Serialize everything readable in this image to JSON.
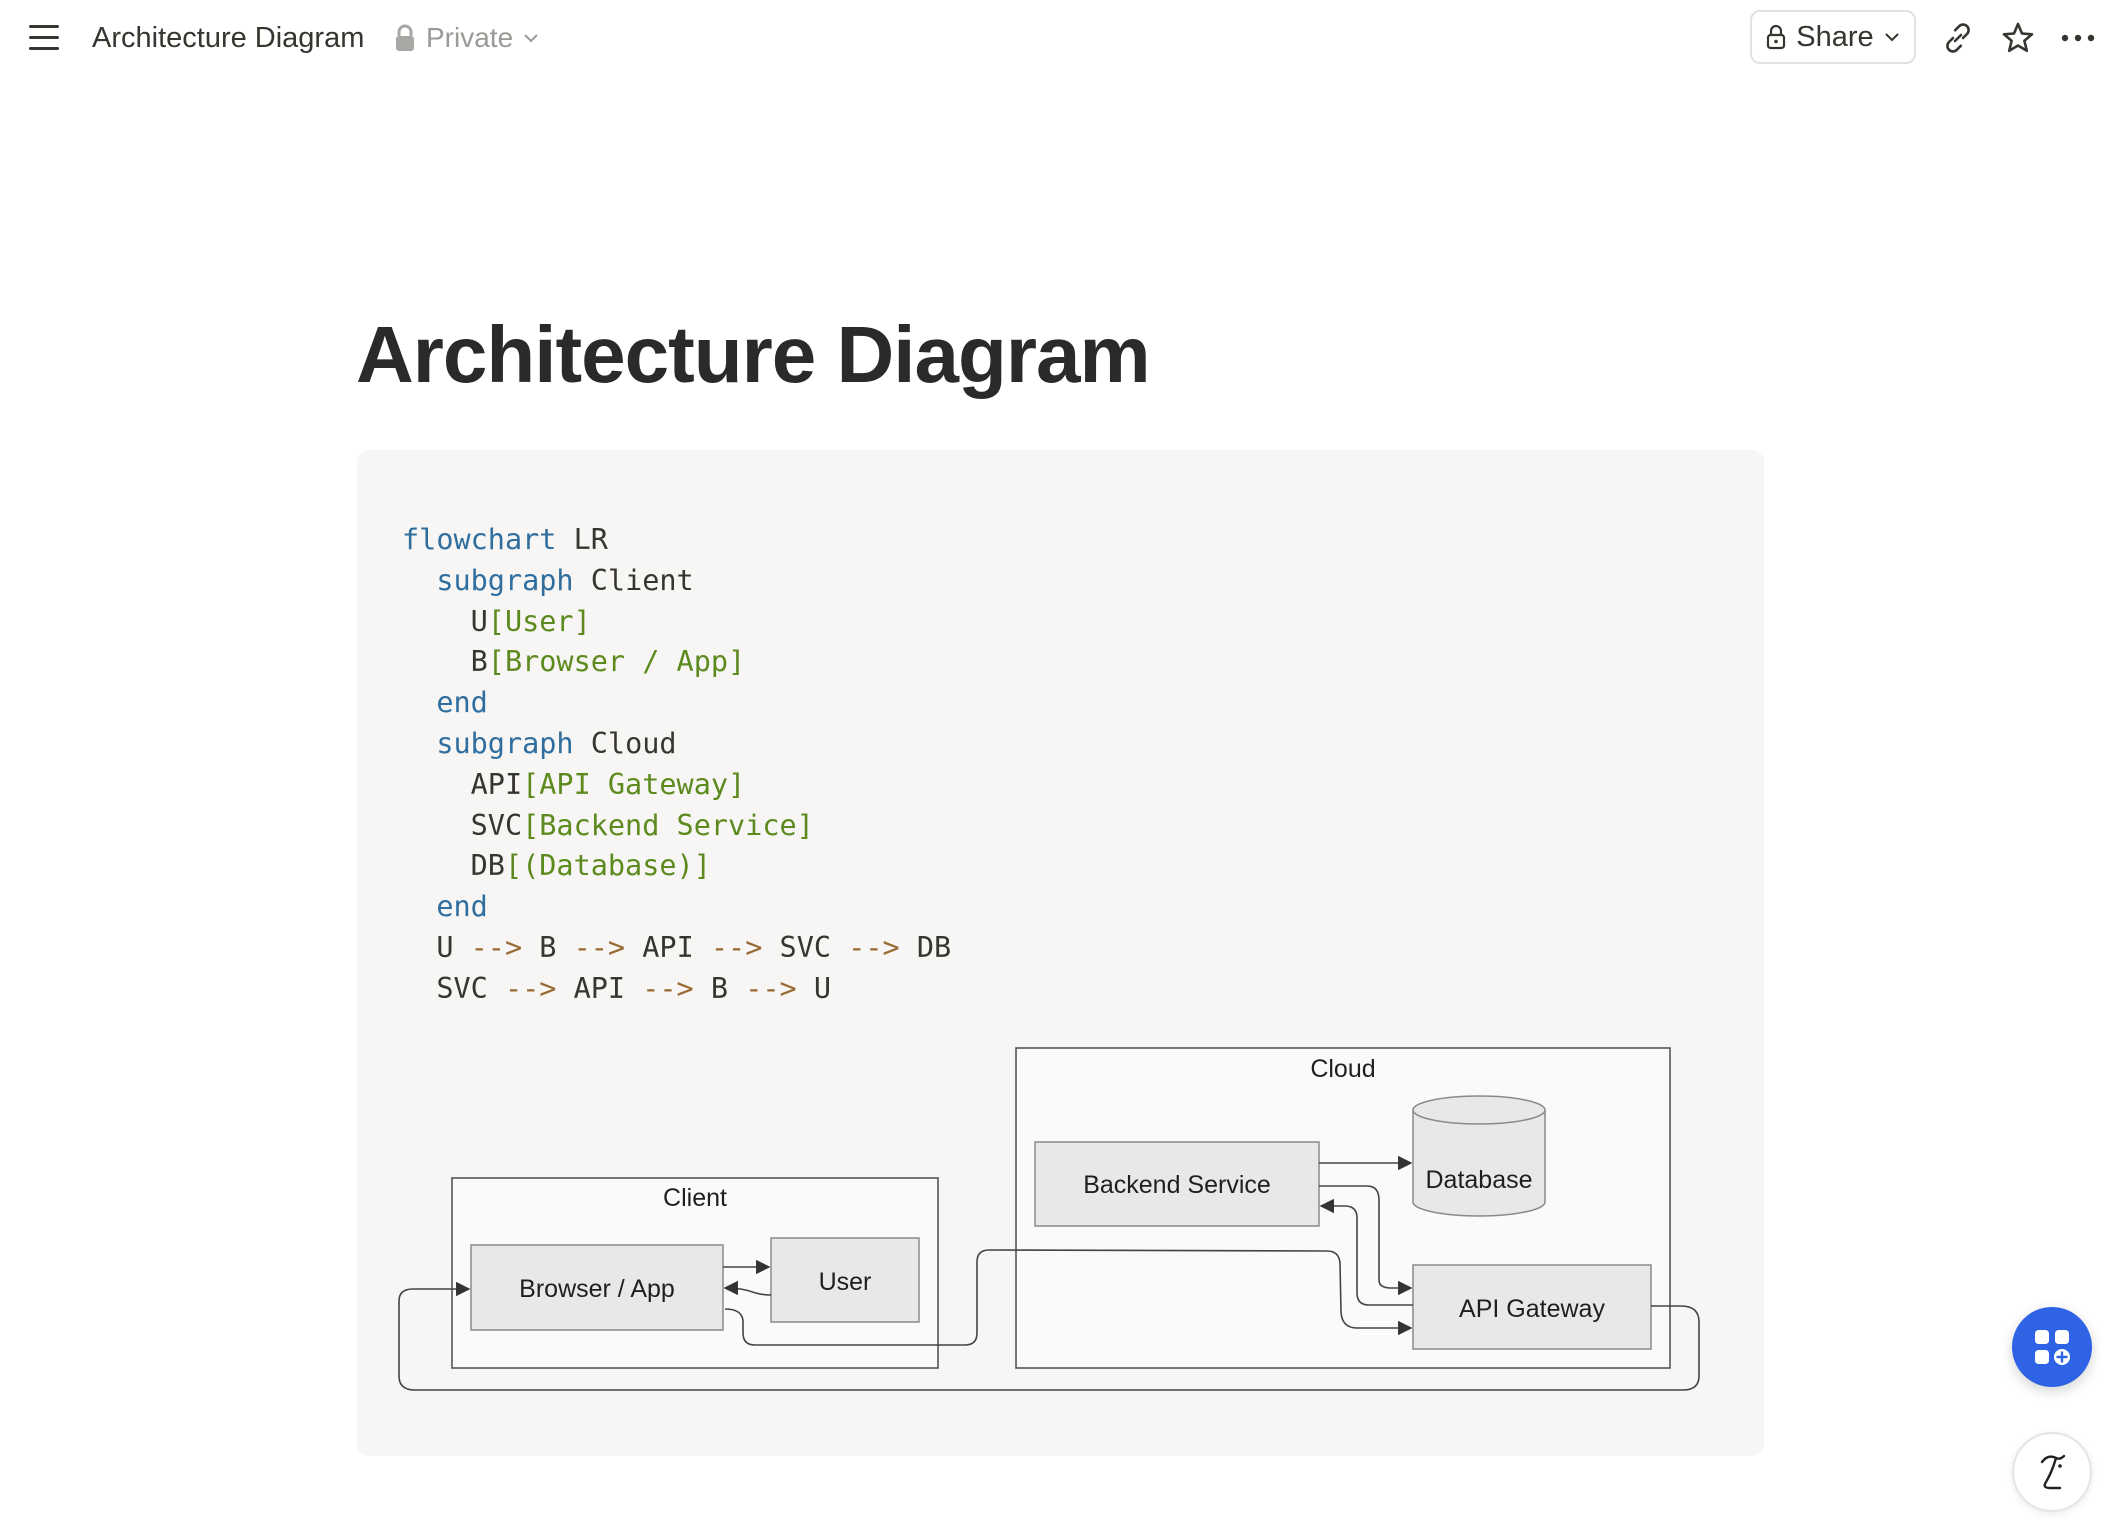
{
  "header": {
    "breadcrumb_title": "Architecture Diagram",
    "privacy_label": "Private",
    "share_label": "Share"
  },
  "page": {
    "title": "Architecture Diagram"
  },
  "code": {
    "lines": [
      [
        [
          "kw",
          "flowchart"
        ],
        [
          "t",
          " LR"
        ]
      ],
      [
        [
          "t",
          "  "
        ],
        [
          "kw",
          "subgraph"
        ],
        [
          "t",
          " Client"
        ]
      ],
      [
        [
          "t",
          "    U"
        ],
        [
          "str",
          "[User]"
        ]
      ],
      [
        [
          "t",
          "    B"
        ],
        [
          "str",
          "[Browser / App]"
        ]
      ],
      [
        [
          "t",
          "  "
        ],
        [
          "kw",
          "end"
        ]
      ],
      [
        [
          "t",
          "  "
        ],
        [
          "kw",
          "subgraph"
        ],
        [
          "t",
          " Cloud"
        ]
      ],
      [
        [
          "t",
          "    API"
        ],
        [
          "str",
          "[API Gateway]"
        ]
      ],
      [
        [
          "t",
          "    SVC"
        ],
        [
          "str",
          "[Backend Service]"
        ]
      ],
      [
        [
          "t",
          "    DB"
        ],
        [
          "str",
          "[(Database)]"
        ]
      ],
      [
        [
          "t",
          "  "
        ],
        [
          "kw",
          "end"
        ]
      ],
      [
        [
          "t",
          "  U "
        ],
        [
          "op",
          "-->"
        ],
        [
          "t",
          " B "
        ],
        [
          "op",
          "-->"
        ],
        [
          "t",
          " API "
        ],
        [
          "op",
          "-->"
        ],
        [
          "t",
          " SVC "
        ],
        [
          "op",
          "-->"
        ],
        [
          "t",
          " DB"
        ]
      ],
      [
        [
          "t",
          "  SVC "
        ],
        [
          "op",
          "-->"
        ],
        [
          "t",
          " API "
        ],
        [
          "op",
          "-->"
        ],
        [
          "t",
          " B "
        ],
        [
          "op",
          "-->"
        ],
        [
          "t",
          " U"
        ]
      ]
    ]
  },
  "diagram": {
    "subgraph_client": "Client",
    "subgraph_cloud": "Cloud",
    "node_browser": "Browser / App",
    "node_user": "User",
    "node_backend": "Backend Service",
    "node_database": "Database",
    "node_api": "API Gateway"
  },
  "icons": {
    "menu": "hamburger-icon",
    "privacy": "lock-icon",
    "share": "lock-icon",
    "link": "link-icon",
    "favorite": "star-icon",
    "more": "more-horizontal-icon",
    "fab": "apps-add-icon",
    "help": "assistant-icon"
  },
  "colors": {
    "fab": "#2f63e6",
    "keyword": "#2f6e9e",
    "string": "#5d8a1e",
    "operator": "#9a6a36"
  }
}
